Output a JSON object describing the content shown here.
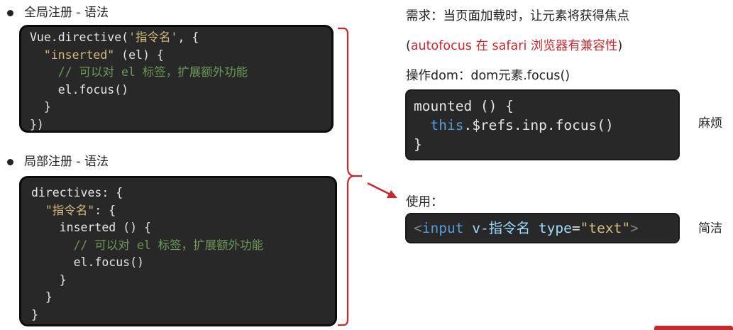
{
  "global": {
    "bullet": "全局注册 - 语法",
    "code": {
      "l1a": "Vue.directive(",
      "l1s": "'指令名'",
      "l1b": ", {",
      "l2s": "\"inserted\"",
      "l2b": " (el) {",
      "l3": "// 可以对 el 标签，扩展额外功能",
      "l4": "el.focus()",
      "l5": "}",
      "l6": "})"
    }
  },
  "local": {
    "bullet": "局部注册 - 语法",
    "code": {
      "l1": "directives: {",
      "l2s": "\"指令名\"",
      "l2b": ": {",
      "l3": "inserted () {",
      "l4": "// 可以对 el 标签，扩展额外功能",
      "l5": "el.focus()",
      "l6": "}",
      "l7": "}",
      "l8": "}"
    }
  },
  "right": {
    "requirement": "需求：当页面加载时，让元素将获得焦点",
    "compat_open": "(",
    "compat_red": "autofocus 在 safari 浏览器有兼容性",
    "compat_close": ")",
    "dom_op": "操作dom：dom元素.focus()",
    "mounted": {
      "l1": "mounted () {",
      "l2a": "this",
      "l2b": ".$refs.inp.focus()",
      "l3": "}"
    },
    "note_trouble": "麻烦",
    "usage_label": "使用：",
    "usage_code": {
      "lt": "<",
      "tag": "input",
      "sp": " ",
      "dir": "v-指令名",
      "attr": " type",
      "eq": "=",
      "val": "\"text\"",
      "gt": ">"
    },
    "note_simple": "简洁"
  },
  "colors": {
    "accent": "#c7292f",
    "code_bg": "#282828"
  }
}
